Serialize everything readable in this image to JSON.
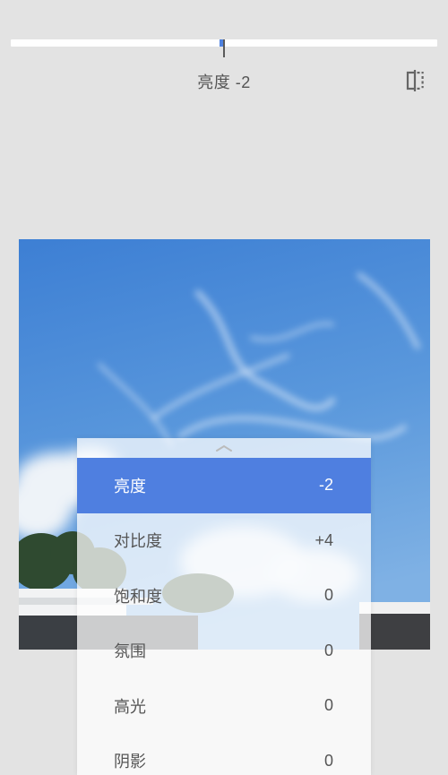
{
  "adjustment": {
    "label": "亮度 -2",
    "slider_value": -2,
    "slider_min": -100,
    "slider_max": 100,
    "accent_color": "#4f82e0"
  },
  "toolbar": {
    "compare_icon": "compare-split-icon"
  },
  "menu": {
    "handle_icon": "chevron-up-icon",
    "selected_color": "#4f7fe0",
    "items": [
      {
        "label": "亮度",
        "value": "-2",
        "selected": true
      },
      {
        "label": "对比度",
        "value": "+4",
        "selected": false
      },
      {
        "label": "饱和度",
        "value": "0",
        "selected": false
      },
      {
        "label": "氛围",
        "value": "0",
        "selected": false
      },
      {
        "label": "高光",
        "value": "0",
        "selected": false
      },
      {
        "label": "阴影",
        "value": "0",
        "selected": false
      }
    ]
  }
}
